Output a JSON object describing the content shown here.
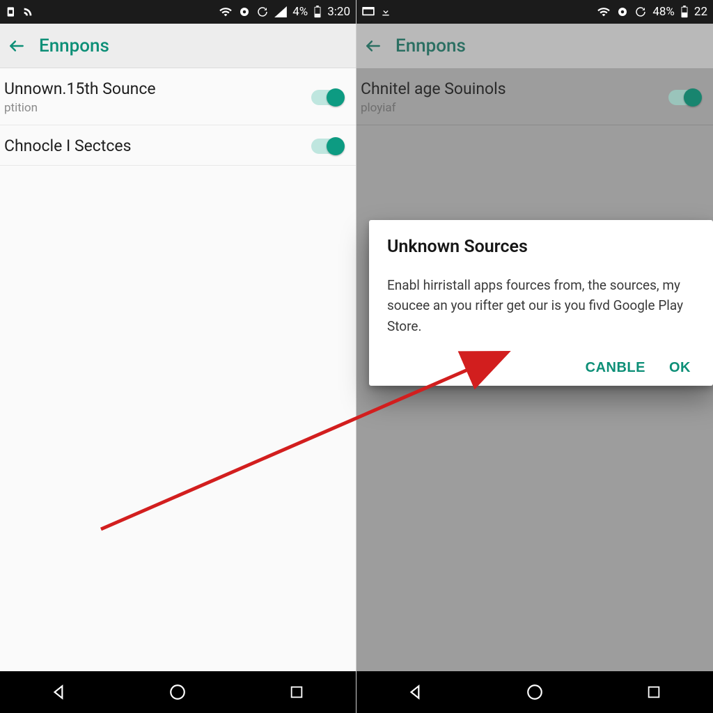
{
  "colors": {
    "accent": "#0d8f77"
  },
  "left_phone": {
    "statusbar": {
      "left_glyphs": [
        "sim-icon",
        "rss-icon"
      ],
      "battery_pct": "4%",
      "time": "3:20"
    },
    "appbar": {
      "title": "Ennpons"
    },
    "settings": [
      {
        "title": "Unnown.15th Sounce",
        "sub": "ptition",
        "toggle_on": true
      },
      {
        "title": "Chnocle I Sectces",
        "sub": "",
        "toggle_on": true
      }
    ]
  },
  "right_phone": {
    "statusbar": {
      "left_glyphs": [
        "window-icon",
        "download-icon"
      ],
      "battery_pct": "48%",
      "time": "22"
    },
    "appbar": {
      "title": "Ennpons"
    },
    "settings": [
      {
        "title": "Chnitel age Souinols",
        "sub": "ployiaf",
        "toggle_on": true
      }
    ],
    "dialog": {
      "title": "Unknown Sources",
      "body": "Enabl hirristall apps fources from, the sources, my soucee an you rifter get our is you fivd Google Play Store.",
      "cancel_label": "CANBLE",
      "ok_label": "OK"
    }
  }
}
